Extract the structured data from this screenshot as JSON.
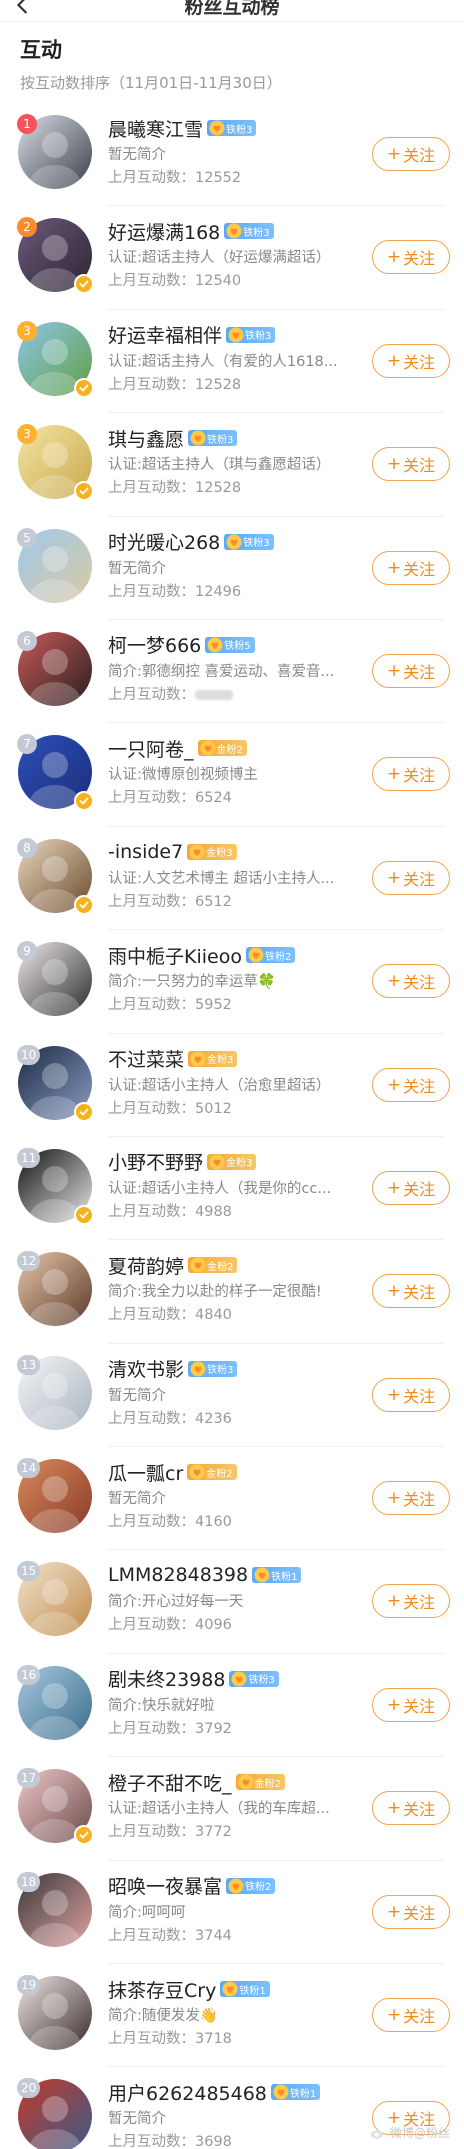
{
  "header": {
    "title": "粉丝互动榜"
  },
  "section": {
    "title": "互动",
    "sort_note": "按互动数排序（11月01日-11月30日）"
  },
  "follow_label": "关注",
  "users": [
    {
      "rank": "1",
      "name": "晨曦寒江雪",
      "fan": "铁粉3",
      "fan_type": "iron",
      "desc": "暂无简介",
      "count": "上月互动数：12552",
      "verified": false,
      "avatar": [
        "#d8dde6",
        "#3a3f4a"
      ]
    },
    {
      "rank": "2",
      "name": "好运爆满168",
      "fan": "铁粉3",
      "fan_type": "iron",
      "desc": "认证:超话主持人（好运爆满超话）",
      "count": "上月互动数：12540",
      "verified": true,
      "avatar": [
        "#6b5a7a",
        "#2c2433"
      ]
    },
    {
      "rank": "3",
      "name": "好运幸福相伴",
      "fan": "铁粉3",
      "fan_type": "iron",
      "desc": "认证:超话主持人（有爱的人1618...",
      "count": "上月互动数：12528",
      "verified": true,
      "avatar": [
        "#8fc6e8",
        "#5f9e44"
      ]
    },
    {
      "rank": "3",
      "name": "琪与鑫愿",
      "fan": "铁粉3",
      "fan_type": "iron",
      "desc": "认证:超话主持人（琪与鑫愿超话）",
      "count": "上月互动数：12528",
      "verified": true,
      "avatar": [
        "#f3e5a6",
        "#c9a84a"
      ]
    },
    {
      "rank": "5",
      "name": "时光暖心268",
      "fan": "铁粉3",
      "fan_type": "iron",
      "desc": "暂无简介",
      "count": "上月互动数：12496",
      "verified": false,
      "avatar": [
        "#9fc9ea",
        "#d9c9a6"
      ]
    },
    {
      "rank": "6",
      "name": "柯一梦666",
      "fan": "铁粉5",
      "fan_type": "iron",
      "desc": "简介:郭德纲控 喜爱运动、喜爱音...",
      "count": "上月互动数：",
      "count_hidden": true,
      "verified": false,
      "avatar": [
        "#c75a5a",
        "#2a1e1e"
      ]
    },
    {
      "rank": "7",
      "name": "一只阿卷_",
      "fan": "金粉2",
      "fan_type": "gold",
      "desc": "认证:微博原创视频博主",
      "count": "上月互动数：6524",
      "verified": true,
      "avatar": [
        "#2d4fb8",
        "#1a2f7a"
      ]
    },
    {
      "rank": "8",
      "name": "-inside7",
      "fan": "金粉3",
      "fan_type": "gold",
      "desc": "认证:人文艺术博主 超话小主持人...",
      "count": "上月互动数：6512",
      "verified": true,
      "avatar": [
        "#e9d8c0",
        "#6a4a2a"
      ]
    },
    {
      "rank": "9",
      "name": "雨中栀子Kiieoo",
      "fan": "铁粉2",
      "fan_type": "iron",
      "desc": "简介:一只努力的幸运草🍀",
      "count": "上月互动数：5952",
      "verified": false,
      "avatar": [
        "#f0eaea",
        "#2a2a2a"
      ]
    },
    {
      "rank": "10",
      "name": "不过菜菜",
      "fan": "金粉3",
      "fan_type": "gold",
      "desc": "认证:超话小主持人（治愈里超话）",
      "count": "上月互动数：5012",
      "verified": true,
      "avatar": [
        "#1c2a44",
        "#8a9cc2"
      ]
    },
    {
      "rank": "11",
      "name": "小野不野野",
      "fan": "金粉3",
      "fan_type": "gold",
      "desc": "认证:超话小主持人（我是你的cc...",
      "count": "上月互动数：4988",
      "verified": true,
      "avatar": [
        "#111111",
        "#e8e8e8"
      ]
    },
    {
      "rank": "12",
      "name": "夏荷韵婷",
      "fan": "金粉2",
      "fan_type": "gold",
      "desc": "简介:我全力以赴的样子一定很酷!",
      "count": "上月互动数：4840",
      "verified": false,
      "avatar": [
        "#e6c6a8",
        "#5a3a2a"
      ]
    },
    {
      "rank": "13",
      "name": "清欢书影",
      "fan": "铁粉3",
      "fan_type": "iron",
      "desc": "暂无简介",
      "count": "上月互动数：4236",
      "verified": false,
      "avatar": [
        "#f5f5f5",
        "#a8b4c0"
      ]
    },
    {
      "rank": "14",
      "name": "瓜一瓢cr",
      "fan": "金粉2",
      "fan_type": "gold",
      "desc": "暂无简介",
      "count": "上月互动数：4160",
      "verified": false,
      "avatar": [
        "#d88a5a",
        "#8a3a2a"
      ]
    },
    {
      "rank": "15",
      "name": "LMM82848398",
      "fan": "铁粉1",
      "fan_type": "iron",
      "desc": "简介:开心过好每一天",
      "count": "上月互动数：4096",
      "verified": false,
      "avatar": [
        "#f2e4cf",
        "#c08a4a"
      ]
    },
    {
      "rank": "16",
      "name": "剧未终23988",
      "fan": "铁粉3",
      "fan_type": "iron",
      "desc": "简介:快乐就好啦",
      "count": "上月互动数：3792",
      "verified": false,
      "avatar": [
        "#a8c8e0",
        "#3a6e8a"
      ]
    },
    {
      "rank": "17",
      "name": "橙子不甜不吃_",
      "fan": "金粉2",
      "fan_type": "gold",
      "desc": "认证:超话小主持人（我的车库超...",
      "count": "上月互动数：3772",
      "verified": true,
      "avatar": [
        "#f0c8c8",
        "#6a4a4a"
      ]
    },
    {
      "rank": "18",
      "name": "昭唤一夜暴富",
      "fan": "铁粉2",
      "fan_type": "iron",
      "desc": "简介:呵呵呵",
      "count": "上月互动数：3744",
      "verified": false,
      "avatar": [
        "#3a3a3a",
        "#e0a0a0"
      ]
    },
    {
      "rank": "19",
      "name": "抹茶存豆Cry",
      "fan": "铁粉1",
      "fan_type": "iron",
      "desc": "简介:随便发发👋",
      "count": "上月互动数：3718",
      "verified": false,
      "avatar": [
        "#efe7e7",
        "#3a2a2a"
      ]
    },
    {
      "rank": "20",
      "name": "用户6262485468",
      "fan": "铁粉1",
      "fan_type": "iron",
      "desc": "暂无简介",
      "count": "上月互动数：3698",
      "verified": false,
      "avatar": [
        "#c23a2a",
        "#3a5a8a"
      ]
    }
  ],
  "watermark": "微博@粉丝"
}
